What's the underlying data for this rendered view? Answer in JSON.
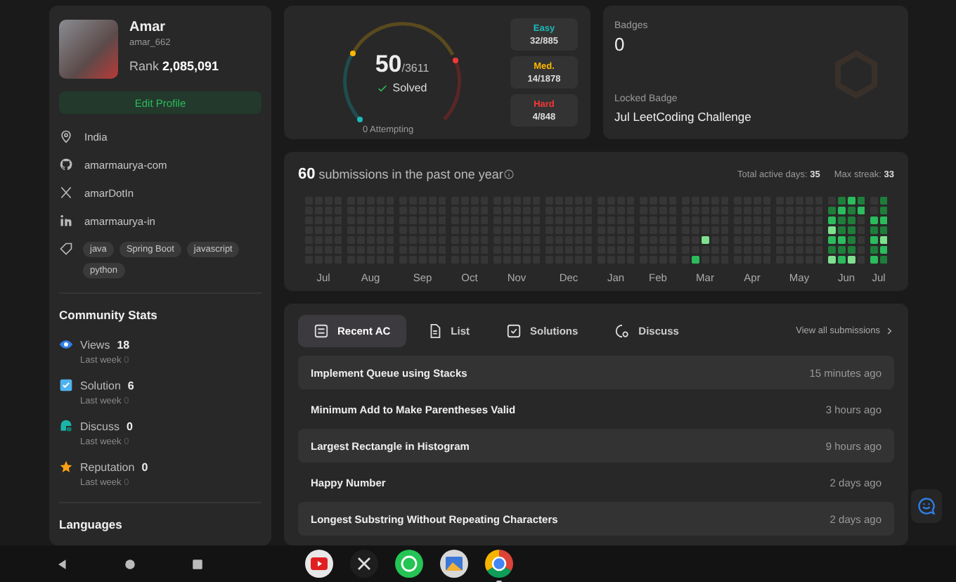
{
  "profile": {
    "name": "Amar",
    "username": "amar_662",
    "rank": "Rank **2,085,091**",
    "edit_button": "Edit Profile",
    "info": [
      {
        "kind": "location",
        "text": "India"
      },
      {
        "kind": "github",
        "text": "amarmaurya-com"
      },
      {
        "kind": "x",
        "text": "amarDotIn"
      },
      {
        "kind": "linkedin",
        "text": "amarmaurya-in"
      }
    ],
    "skills": [
      "java",
      "Spring Boot",
      "javascript",
      "python"
    ]
  },
  "community_stats": {
    "title": "Community Stats",
    "items": [
      {
        "kind": "views",
        "label": "Views",
        "value": "18",
        "sub_label": "Last week",
        "sub_value": "0"
      },
      {
        "kind": "solution",
        "label": "Solution",
        "value": "6",
        "sub_label": "Last week",
        "sub_value": "0"
      },
      {
        "kind": "discuss",
        "label": "Discuss",
        "value": "0",
        "sub_label": "Last week",
        "sub_value": "0"
      },
      {
        "kind": "reputation",
        "label": "Reputation",
        "value": "0",
        "sub_label": "Last week",
        "sub_value": "0"
      }
    ]
  },
  "languages": {
    "title": "Languages"
  },
  "solved": {
    "count": "50",
    "total": "/3611",
    "label": "Solved",
    "attempting": "0 Attempting",
    "difficulties": [
      {
        "label": "Easy",
        "value": "32/885",
        "color": "#1cbaba"
      },
      {
        "label": "Med.",
        "value": "14/1878",
        "color": "#ffb700"
      },
      {
        "label": "Hard",
        "value": "4/848",
        "color": "#f63737"
      }
    ]
  },
  "badges": {
    "title": "Badges",
    "count": "0",
    "locked_label": "Locked Badge",
    "locked_name": "Jul LeetCoding Challenge"
  },
  "heatmap": {
    "count": "60",
    "caption": "submissions in the past one year",
    "active_days_label": "Total active days:",
    "active_days": "35",
    "streak_label": "Max streak:",
    "streak": "33",
    "months": [
      "Jul",
      "Aug",
      "Sep",
      "Oct",
      "Nov",
      "Dec",
      "Jan",
      "Feb",
      "Mar",
      "Apr",
      "May",
      "Jun",
      "Jul"
    ]
  },
  "tabs": [
    {
      "kind": "recent",
      "label": "Recent AC",
      "selected": true
    },
    {
      "kind": "list",
      "label": "List",
      "selected": false
    },
    {
      "kind": "solutions",
      "label": "Solutions",
      "selected": false
    },
    {
      "kind": "discuss",
      "label": "Discuss",
      "selected": false
    }
  ],
  "view_all": "View all submissions",
  "submissions": [
    {
      "title": "Implement Queue using Stacks",
      "time": "15 minutes ago"
    },
    {
      "title": "Minimum Add to Make Parentheses Valid",
      "time": "3 hours ago"
    },
    {
      "title": "Largest Rectangle in Histogram",
      "time": "9 hours ago"
    },
    {
      "title": "Happy Number",
      "time": "2 days ago"
    },
    {
      "title": "Longest Substring Without Repeating Characters",
      "time": "2 days ago"
    }
  ],
  "taskbar": [
    {
      "kind": "youtube"
    },
    {
      "kind": "x"
    },
    {
      "kind": "whatsapp"
    },
    {
      "kind": "gallery"
    },
    {
      "kind": "chrome",
      "selected": true
    }
  ]
}
